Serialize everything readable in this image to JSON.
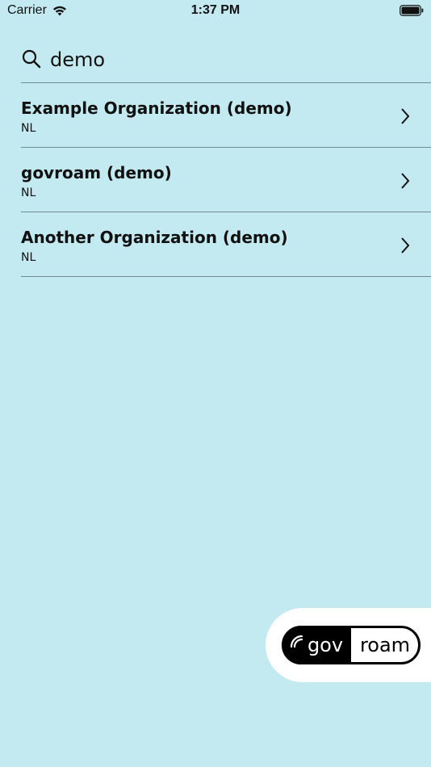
{
  "status_bar": {
    "carrier": "Carrier",
    "time": "1:37 PM"
  },
  "search": {
    "value": "demo"
  },
  "results": [
    {
      "title": "Example Organization (demo)",
      "subtitle": "NL"
    },
    {
      "title": "govroam (demo)",
      "subtitle": "NL"
    },
    {
      "title": "Another Organization (demo)",
      "subtitle": "NL"
    }
  ],
  "logo": {
    "left_text": "gov",
    "right_text": "roam"
  },
  "colors": {
    "background": "#c3eaf0",
    "divider": "#6f8a8e",
    "logo_card": "#ffffff"
  }
}
